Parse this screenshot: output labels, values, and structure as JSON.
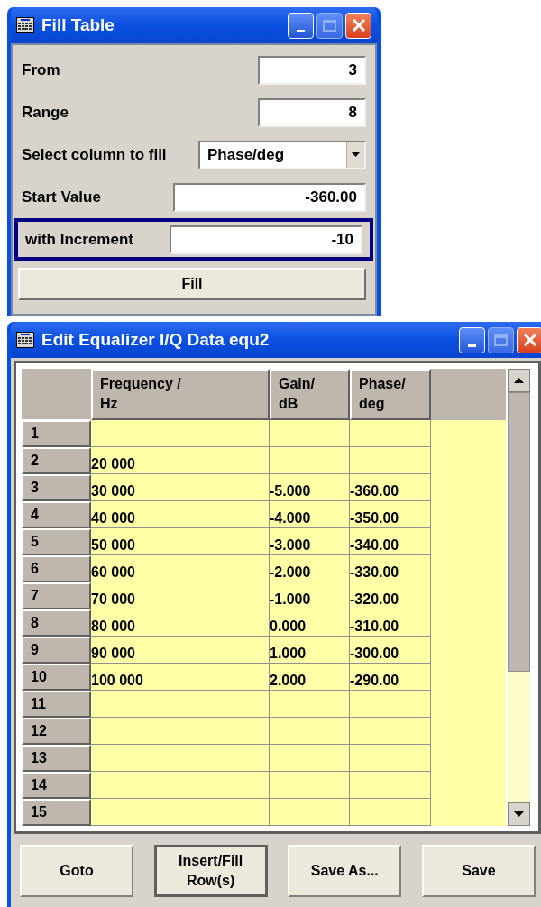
{
  "fill_window": {
    "title": "Fill Table",
    "fields": [
      {
        "kind": "input",
        "label": "From",
        "value": "3",
        "focused": false
      },
      {
        "kind": "input",
        "label": "Range",
        "value": "8",
        "focused": false
      },
      {
        "kind": "select",
        "label": "Select column to fill",
        "value": "Phase/deg",
        "focused": false
      },
      {
        "kind": "input",
        "label": "Start Value",
        "value": "-360.00",
        "focused": false
      },
      {
        "kind": "input",
        "label": "with Increment",
        "value": "-10",
        "focused": true
      }
    ],
    "button": "Fill"
  },
  "edit_window": {
    "title": "Edit Equalizer I/Q Data equ2",
    "columns": [
      "Frequency /\nHz",
      "Gain/\ndB",
      "Phase/\ndeg"
    ],
    "rows": [
      {
        "label": "1"
      },
      {
        "label": "2",
        "frequency": "20 000"
      },
      {
        "label": "3",
        "frequency": "30 000",
        "gain": "-5.000",
        "phase": "-360.00"
      },
      {
        "label": "4",
        "frequency": "40 000",
        "gain": "-4.000",
        "phase": "-350.00"
      },
      {
        "label": "5",
        "frequency": "50 000",
        "gain": "-3.000",
        "phase": "-340.00"
      },
      {
        "label": "6",
        "frequency": "60 000",
        "gain": "-2.000",
        "phase": "-330.00"
      },
      {
        "label": "7",
        "frequency": "70 000",
        "gain": "-1.000",
        "phase": "-320.00"
      },
      {
        "label": "8",
        "frequency": "80 000",
        "gain": "0.000",
        "phase": "-310.00"
      },
      {
        "label": "9",
        "frequency": "90 000",
        "gain": "1.000",
        "phase": "-300.00"
      },
      {
        "label": "10",
        "frequency": "100 000",
        "gain": "2.000",
        "phase": "-290.00"
      },
      {
        "label": "11"
      },
      {
        "label": "12"
      },
      {
        "label": "13"
      },
      {
        "label": "14"
      },
      {
        "label": "15"
      }
    ],
    "buttons": [
      {
        "label": "Goto",
        "focused": false
      },
      {
        "label": "Insert/Fill\nRow(s)",
        "focused": true
      },
      {
        "label": "Save As...",
        "focused": false
      },
      {
        "label": "Save",
        "focused": false
      }
    ]
  }
}
